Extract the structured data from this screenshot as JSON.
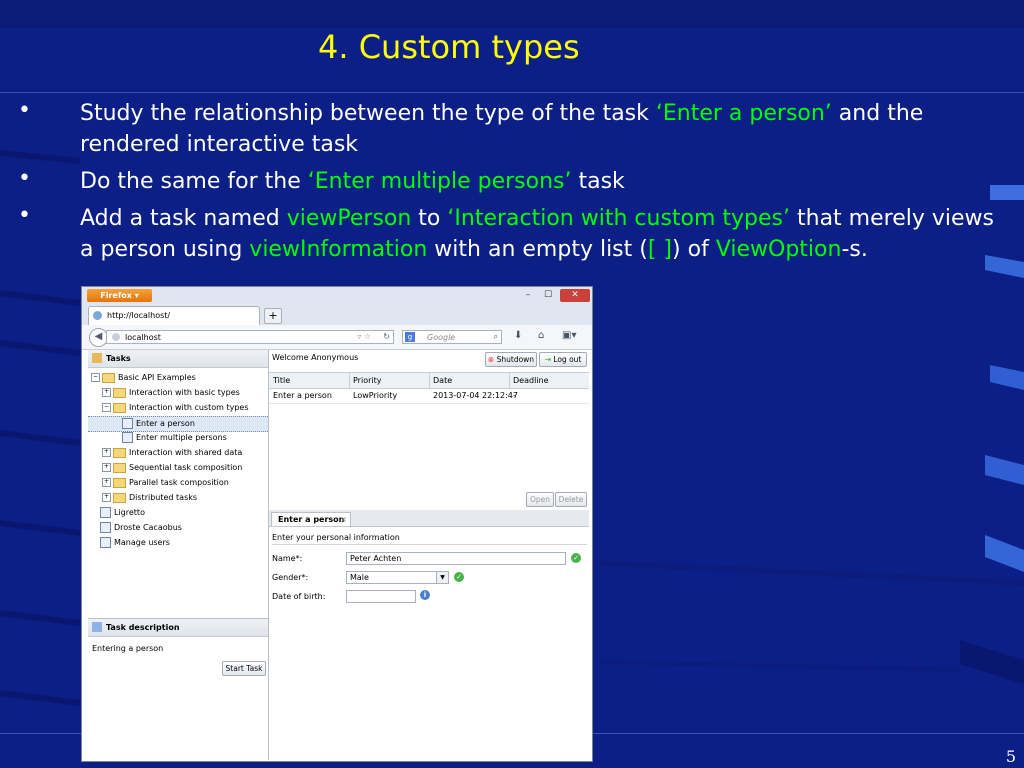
{
  "slide": {
    "title": "4. Custom types",
    "page_number": "5",
    "bullets": [
      {
        "marker": "•",
        "parts": [
          {
            "text": "Study the relationship between the type of the task ",
            "highlight": false
          },
          {
            "text": "‘Enter a person’",
            "highlight": true
          },
          {
            "text": " and the rendered interactive task",
            "highlight": false
          }
        ]
      },
      {
        "marker": "•",
        "parts": [
          {
            "text": "Do the same for the ",
            "highlight": false
          },
          {
            "text": "‘Enter multiple persons’",
            "highlight": true
          },
          {
            "text": " task",
            "highlight": false
          }
        ]
      },
      {
        "marker": "•",
        "parts": [
          {
            "text": "Add a task named ",
            "highlight": false
          },
          {
            "text": "viewPerson",
            "highlight": true
          },
          {
            "text": " to ",
            "highlight": false
          },
          {
            "text": "‘Interaction with custom types’",
            "highlight": true
          },
          {
            "text": " that merely views a person using ",
            "highlight": false
          },
          {
            "text": "viewInformation",
            "highlight": true
          },
          {
            "text": " with an empty list (",
            "highlight": false
          },
          {
            "text": "[ ]",
            "highlight": true
          },
          {
            "text": ") of ",
            "highlight": false
          },
          {
            "text": "ViewOption",
            "highlight": true
          },
          {
            "text": "-s.",
            "highlight": false
          }
        ]
      }
    ],
    "colors": {
      "background": "#0b1f86",
      "title": "#ffff00",
      "highlight": "#00ff00",
      "text": "#ffffff"
    }
  },
  "browser": {
    "app_button": "Firefox ▾",
    "window_controls": [
      "–",
      "☐",
      "✕"
    ],
    "tab_title": "http://localhost/",
    "new_tab": "+",
    "url": "localhost",
    "search_placeholder": "Google",
    "search_engine_badge": "g",
    "nav_icons": [
      "download-icon",
      "home-icon",
      "menu-icon"
    ]
  },
  "app": {
    "tasks_header": "Tasks",
    "tree": [
      {
        "label": "Basic API Examples",
        "type": "folder",
        "toggle": "⊟"
      },
      {
        "label": "Interaction with basic types",
        "type": "folder",
        "toggle": "⊞"
      },
      {
        "label": "Interaction with custom types",
        "type": "folder",
        "toggle": "⊟"
      },
      {
        "label": "Enter a person",
        "type": "task",
        "selected": true
      },
      {
        "label": "Enter multiple persons",
        "type": "task"
      },
      {
        "label": "Interaction with shared data",
        "type": "folder",
        "toggle": "⊞"
      },
      {
        "label": "Sequential task composition",
        "type": "folder",
        "toggle": "⊞"
      },
      {
        "label": "Parallel task composition",
        "type": "folder",
        "toggle": "⊞"
      },
      {
        "label": "Distributed tasks",
        "type": "folder",
        "toggle": "⊞"
      },
      {
        "label": "Ligretto",
        "type": "task"
      },
      {
        "label": "Droste Cacaobus",
        "type": "task"
      },
      {
        "label": "Manage users",
        "type": "task"
      }
    ],
    "description_header": "Task description",
    "description_text": "Entering a person",
    "start_task_button": "Start Task",
    "welcome": "Welcome Anonymous",
    "shutdown_button": "Shutdown",
    "logout_button": "Log out",
    "grid": {
      "columns": [
        "Title",
        "Priority",
        "Date",
        "Deadline"
      ],
      "rows": [
        [
          "Enter a person",
          "LowPriority",
          "2013-07-04 22:12:47",
          "-"
        ]
      ]
    },
    "open_button": "Open",
    "delete_button": "Delete",
    "form_tab": "Enter a person",
    "form_tab_close": "×",
    "form_intro": "Enter your personal information",
    "fields": {
      "name_label": "Name*:",
      "name_value": "Peter Achten",
      "gender_label": "Gender*:",
      "gender_value": "Male",
      "dob_label": "Date of birth:",
      "dob_value": ""
    }
  }
}
